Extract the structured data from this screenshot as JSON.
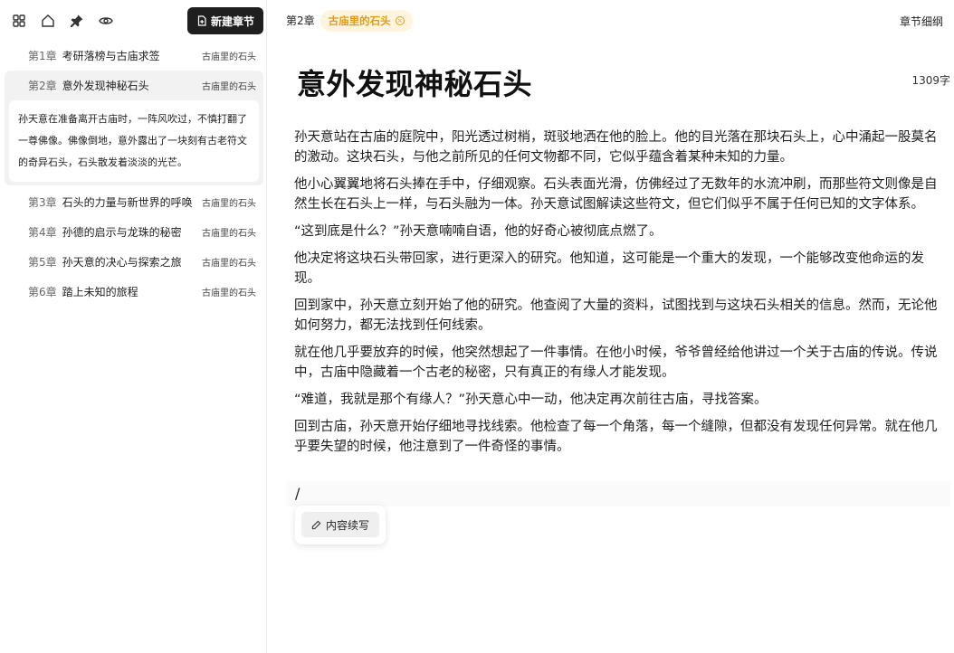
{
  "sidebar": {
    "toolbar_icons": [
      "grid-icon",
      "home-icon",
      "pin-icon",
      "eye-icon"
    ],
    "new_chapter_label": "新建章节",
    "chapters": [
      {
        "num": "第1章",
        "title": "考研落榜与古庙求签",
        "tag": "古庙里的石头"
      },
      {
        "num": "第2章",
        "title": "意外发现神秘石头",
        "tag": "古庙里的石头",
        "active": true,
        "summary": "孙天意在准备离开古庙时，一阵风吹过，不慎打翻了一尊佛像。佛像倒地，意外露出了一块刻有古老符文的奇异石头，石头散发着淡淡的光芒。"
      },
      {
        "num": "第3章",
        "title": "石头的力量与新世界的呼唤",
        "tag": "古庙里的石头"
      },
      {
        "num": "第4章",
        "title": "孙德的启示与龙珠的秘密",
        "tag": "古庙里的石头"
      },
      {
        "num": "第5章",
        "title": "孙天意的决心与探索之旅",
        "tag": "古庙里的石头"
      },
      {
        "num": "第6章",
        "title": "踏上未知的旅程",
        "tag": "古庙里的石头"
      }
    ]
  },
  "header": {
    "chapter": "第2章",
    "tag": "古庙里的石头",
    "detail_link": "章节细纲"
  },
  "document": {
    "title": "意外发现神秘石头",
    "word_count": "1309字",
    "paragraphs": [
      "孙天意站在古庙的庭院中，阳光透过树梢，斑驳地洒在他的脸上。他的目光落在那块石头上，心中涌起一股莫名的激动。这块石头，与他之前所见的任何文物都不同，它似乎蕴含着某种未知的力量。",
      "他小心翼翼地将石头捧在手中，仔细观察。石头表面光滑，仿佛经过了无数年的水流冲刷，而那些符文则像是自然生长在石头上一样，与石头融为一体。孙天意试图解读这些符文，但它们似乎不属于任何已知的文字体系。",
      "“这到底是什么？”孙天意喃喃自语，他的好奇心被彻底点燃了。",
      "他决定将这块石头带回家，进行更深入的研究。他知道，这可能是一个重大的发现，一个能够改变他命运的发现。",
      "回到家中，孙天意立刻开始了他的研究。他查阅了大量的资料，试图找到与这块石头相关的信息。然而，无论他如何努力，都无法找到任何线索。",
      "就在他几乎要放弃的时候，他突然想起了一件事情。在他小时候，爷爷曾经给他讲过一个关于古庙的传说。传说中，古庙中隐藏着一个古老的秘密，只有真正的有缘人才能发现。",
      "“难道，我就是那个有缘人？”孙天意心中一动，他决定再次前往古庙，寻找答案。",
      "回到古庙，孙天意开始仔细地寻找线索。他检查了每一个角落，每一个缝隙，但都没有发现任何异常。就在他几乎要失望的时候，他注意到了一件奇怪的事情。"
    ],
    "slash_input": "/",
    "popup_action": "内容续写"
  }
}
